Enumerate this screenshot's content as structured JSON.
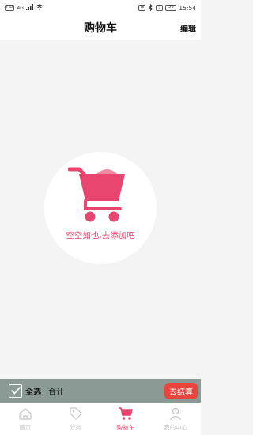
{
  "status_bar": {
    "left_badge": "HD",
    "signal": "4G",
    "nfc_badge": "N",
    "vibrate_badge": "▯",
    "battery": "55",
    "time": "15:54"
  },
  "header": {
    "title": "购物车",
    "edit_label": "编辑"
  },
  "empty_state": {
    "message": "空空如也,去添加吧"
  },
  "bottom_bar": {
    "select_all_label": "全选",
    "total_label": "合计",
    "checkout_label": "去结算"
  },
  "tabs": [
    {
      "label": "首页",
      "icon": "home-icon",
      "active": false
    },
    {
      "label": "分类",
      "icon": "tag-icon",
      "active": false
    },
    {
      "label": "购物车",
      "icon": "cart-icon",
      "active": true
    },
    {
      "label": "我的中心",
      "icon": "user-icon",
      "active": false
    }
  ],
  "colors": {
    "accent": "#e8456f",
    "checkout": "#e8453c",
    "bottom_bar": "#8c9a96",
    "inactive_tab": "#c4c4c4"
  }
}
